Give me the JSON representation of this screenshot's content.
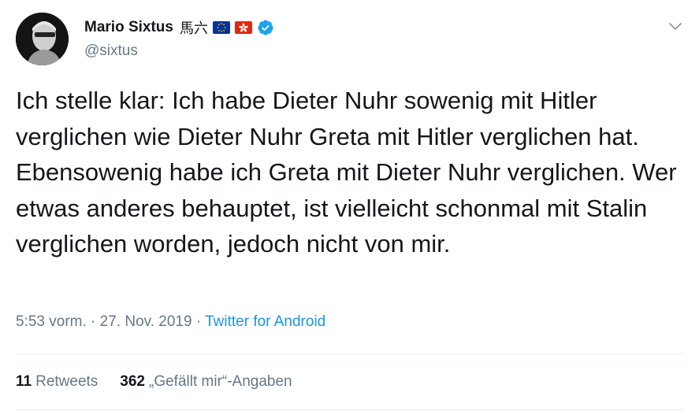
{
  "user": {
    "display_name": "Mario Sixtus",
    "name_suffix": "馬六",
    "handle": "@sixtus",
    "flags": [
      "eu-flag-icon",
      "hong-kong-flag-icon"
    ],
    "verified_icon": "verified-badge-icon"
  },
  "tweet": {
    "text": "Ich stelle klar: Ich habe Dieter Nuhr sowenig mit Hitler verglichen wie Dieter Nuhr Greta mit Hitler verglichen hat. Ebensowenig habe ich Greta mit Dieter Nuhr verglichen. Wer etwas anderes behauptet, ist vielleicht schonmal mit Stalin verglichen worden, jedoch nicht von mir.",
    "time": "5:53 vorm.",
    "sep1": " · ",
    "date": "27. Nov. 2019",
    "sep2": " · ",
    "source": "Twitter for Android"
  },
  "stats": {
    "retweets_count": "11",
    "retweets_label": "Retweets",
    "likes_count": "362",
    "likes_label": "„Gefällt mir“-Angaben"
  },
  "colors": {
    "text": "#14171a",
    "secondary": "#657786",
    "link": "#1b95e0",
    "verified": "#1da1f2",
    "divider": "#e6ecf0"
  },
  "icons": {
    "menu": "chevron-down-icon"
  }
}
